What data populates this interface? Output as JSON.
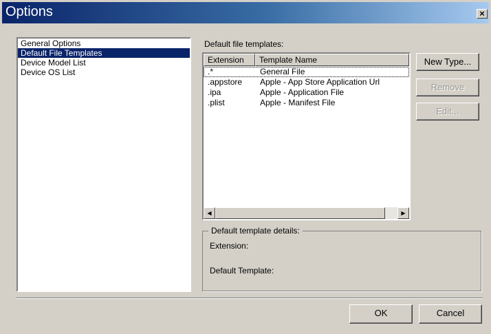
{
  "window": {
    "title": "Options",
    "close_glyph": "×"
  },
  "nav": {
    "items": [
      {
        "label": "General Options",
        "selected": false
      },
      {
        "label": "Default File Templates",
        "selected": true
      },
      {
        "label": "Device Model List",
        "selected": false
      },
      {
        "label": "Device OS List",
        "selected": false
      }
    ]
  },
  "templates": {
    "section_label": "Default file templates:",
    "columns": {
      "extension": "Extension",
      "template_name": "Template Name"
    },
    "rows": [
      {
        "extension": ".*",
        "template_name": "General File"
      },
      {
        "extension": ".appstore",
        "template_name": "Apple - App Store Application Url"
      },
      {
        "extension": ".ipa",
        "template_name": "Apple - Application File"
      },
      {
        "extension": ".plist",
        "template_name": "Apple - Manifest File"
      }
    ],
    "scroll_left_icon": "◀",
    "scroll_right_icon": "▶"
  },
  "actions": {
    "new_type": "New Type...",
    "remove": "Remove",
    "edit": "Edit..."
  },
  "details": {
    "legend": "Default template details:",
    "extension_label": "Extension:",
    "default_template_label": "Default Template:"
  },
  "footer": {
    "ok": "OK",
    "cancel": "Cancel"
  }
}
